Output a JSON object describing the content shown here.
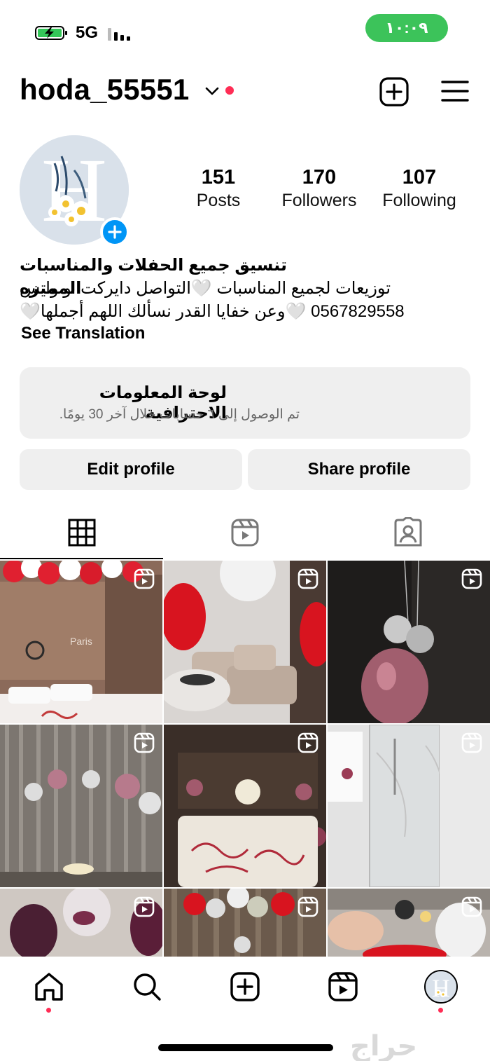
{
  "status": {
    "network": "5G",
    "time": "١٠:٠٩"
  },
  "header": {
    "username": "hoda_55551",
    "icons": [
      "chevron-down-icon",
      "notification-dot",
      "new-post-icon",
      "menu-icon"
    ]
  },
  "stats": [
    {
      "value": "151",
      "label": "Posts"
    },
    {
      "value": "170",
      "label": "Followers"
    },
    {
      "value": "107",
      "label": "Following"
    }
  ],
  "bio": {
    "name": "تنسيق جميع الحفلات والمناسبات المميزه",
    "line1": "توزيعات لجميع المناسبات 🤍التواصل دايركت او واتس",
    "line2": "0567829558 🤍وعن خفايا القدر نسألك اللهم أجملها🤍",
    "see_translation": "See Translation"
  },
  "dashboard": {
    "title": "لوحة المعلومات الاحترافية",
    "subtitle": "تم الوصول إلى ٦ حسابات خلال آخر 30 يومًا."
  },
  "buttons": {
    "edit": "Edit profile",
    "share": "Share profile"
  },
  "tabs": [
    "grid-icon",
    "reels-icon",
    "tagged-icon"
  ],
  "grid": {
    "tile1_text": "Paris",
    "tiles": [
      "reel",
      "reel",
      "reel",
      "reel",
      "reel",
      "reel",
      "reel",
      "reel",
      "reel"
    ]
  },
  "bottom_nav": [
    "home-icon",
    "search-icon",
    "create-icon",
    "reels-icon",
    "profile-avatar"
  ],
  "watermark": "حراج",
  "colors": {
    "accent": "#0095f6",
    "notification": "#ff2d55",
    "clock_pill": "#3cc35a"
  }
}
